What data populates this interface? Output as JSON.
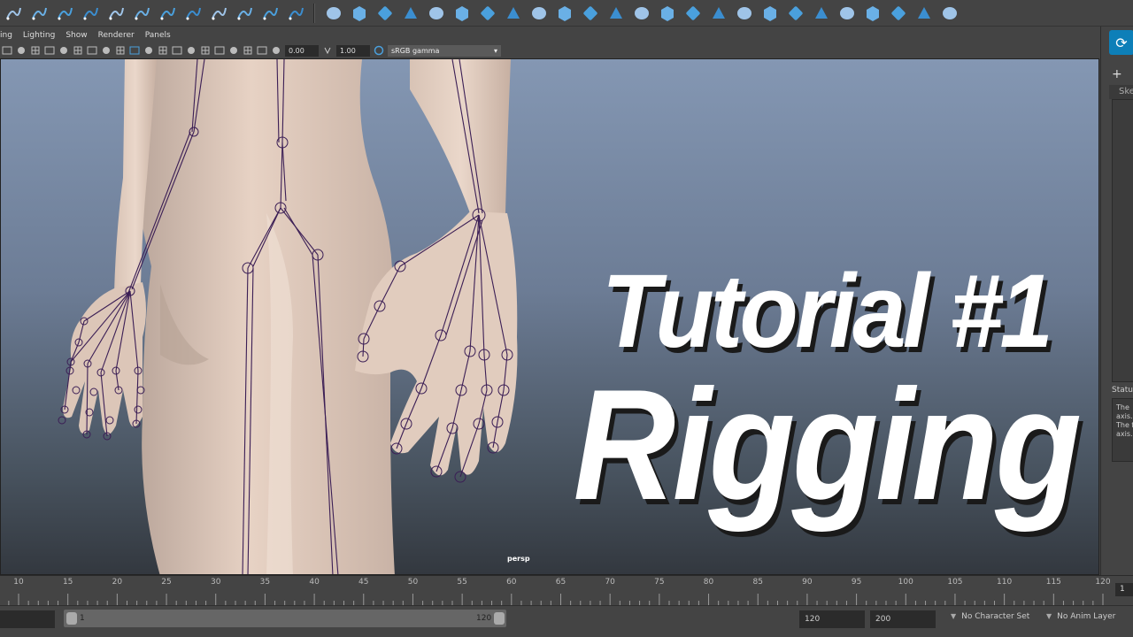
{
  "shelf": {
    "icons": [
      "curve-cv-icon",
      "curve-ep-icon",
      "pencil-curve-icon",
      "arc-icon",
      "spiral-icon",
      "bezier-icon",
      "curve-tool-icon",
      "circle-arc-icon",
      "curve-edit-icon",
      "curve-snap-icon",
      "text-curve-icon",
      "curve-offset-icon",
      "sphere-icon",
      "cube-icon",
      "cylinder-icon",
      "cone-icon",
      "plane-icon",
      "torus-icon",
      "revolve-icon",
      "loft-icon",
      "extrude-icon",
      "planar-icon",
      "birail-icon",
      "boundary-icon",
      "square-surface-icon",
      "bevel-icon",
      "fillet-icon",
      "stitch-icon",
      "intersect-icon",
      "trim-icon",
      "untrim-icon",
      "attach-icon",
      "detach-icon",
      "rebuild-icon",
      "insert-isoparm-icon",
      "project-curve-icon",
      "sculpt-icon"
    ]
  },
  "panel_menu": [
    "ing",
    "Lighting",
    "Show",
    "Renderer",
    "Panels"
  ],
  "panel_toolbar": {
    "exposure": "0.00",
    "gamma": "1.00",
    "color_space": "sRGB gamma"
  },
  "viewport": {
    "title_line1": "Tutorial #1",
    "title_line2": "Rigging",
    "camera": "persp"
  },
  "right_panel": {
    "logo": "logo-icon",
    "tab": "Ske",
    "status_label": "Status",
    "status_lines": [
      "The",
      "axis.",
      "The f",
      "axis."
    ]
  },
  "time_slider": {
    "ticks": [
      "10",
      "15",
      "20",
      "25",
      "30",
      "35",
      "40",
      "45",
      "50",
      "55",
      "60",
      "65",
      "70",
      "75",
      "80",
      "85",
      "90",
      "95",
      "100",
      "105",
      "110",
      "115",
      "120"
    ],
    "current_frame": "1"
  },
  "range_bar": {
    "start_field": "",
    "range_start": "1",
    "range_end": "120",
    "end_time": "120",
    "max_time": "200",
    "character_set": "No Character Set",
    "anim_layer": "No Anim Layer"
  }
}
